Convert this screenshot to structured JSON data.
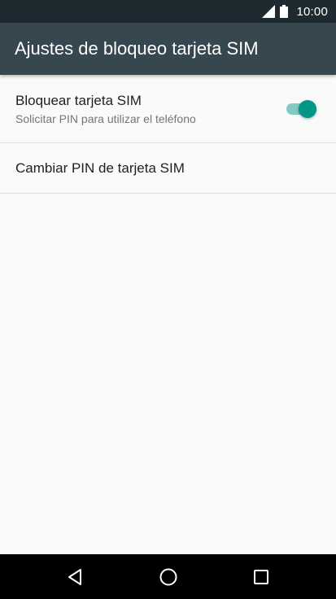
{
  "status_bar": {
    "time": "10:00",
    "icons": [
      "signal-icon",
      "battery-icon"
    ]
  },
  "app_bar": {
    "title": "Ajustes de bloqueo tarjeta SIM"
  },
  "preferences": [
    {
      "title": "Bloquear tarjeta SIM",
      "summary": "Solicitar PIN para utilizar el teléfono",
      "toggle_on": true
    },
    {
      "title": "Cambiar PIN de tarjeta SIM"
    }
  ],
  "nav_bar": {
    "icons": [
      "back-icon",
      "home-icon",
      "recents-icon"
    ]
  },
  "colors": {
    "status_bar": "#1e2a30",
    "app_bar": "#37474f",
    "accent": "#009688",
    "accent_track": "#80cbc4",
    "background": "#fafafa"
  }
}
